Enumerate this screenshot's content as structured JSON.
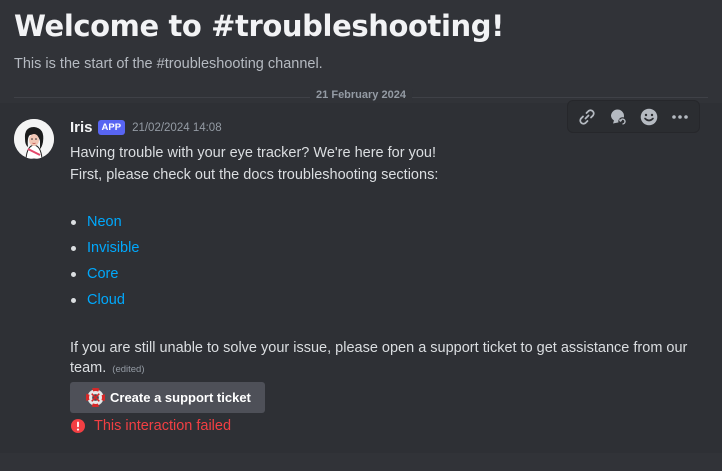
{
  "channel": {
    "welcome_title": "Welcome to #troubleshooting!",
    "welcome_subtitle": "This is the start of the #troubleshooting channel."
  },
  "divider": {
    "date": "21 February 2024"
  },
  "message": {
    "author": "Iris",
    "badge": "APP",
    "timestamp": "21/02/2024 14:08",
    "line1": "Having trouble with your eye tracker? We're here for you!",
    "line2": "First, please check out the docs troubleshooting sections:",
    "links": [
      "Neon",
      "Invisible",
      "Core",
      "Cloud"
    ],
    "footer": "If you are still unable to solve your issue, please open a support ticket to get assistance from our team.",
    "edited": "(edited)",
    "button_label": "Create a support ticket",
    "error": "This interaction failed"
  },
  "toolbar": {
    "icons": [
      "link-icon",
      "thread-icon",
      "add-reaction-icon",
      "more-icon"
    ]
  },
  "colors": {
    "background": "#313338",
    "link": "#00a8fc",
    "badge": "#5865f2",
    "error": "#f23f43"
  }
}
